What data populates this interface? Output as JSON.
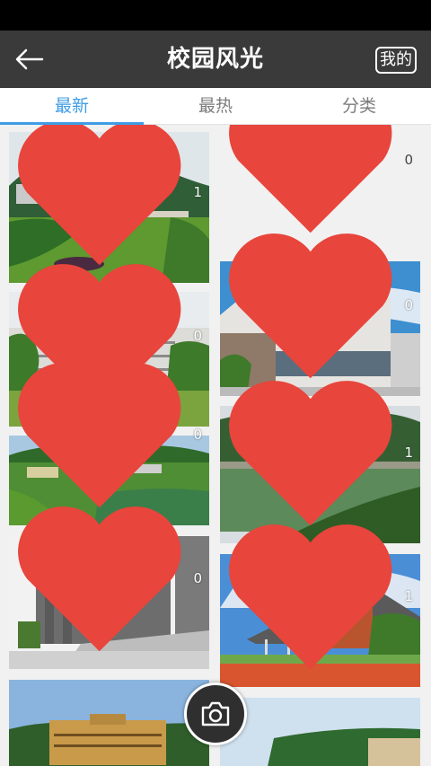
{
  "header": {
    "title": "校园风光",
    "mine_label": "我的"
  },
  "tabs": [
    {
      "label": "最新"
    },
    {
      "label": "最热"
    },
    {
      "label": "分类"
    }
  ],
  "photos": [
    {
      "likes": "1"
    },
    {
      "likes": "0"
    },
    {
      "likes": "0"
    },
    {
      "likes": "1"
    },
    {
      "likes": "0"
    },
    {
      "likes": "0"
    },
    {
      "likes": "0"
    },
    {
      "likes": "1"
    }
  ],
  "top_right_likes": "0",
  "colors": {
    "accent": "#3f9de6",
    "header_bg": "#3a3a3a",
    "heart": "#e8453c"
  }
}
